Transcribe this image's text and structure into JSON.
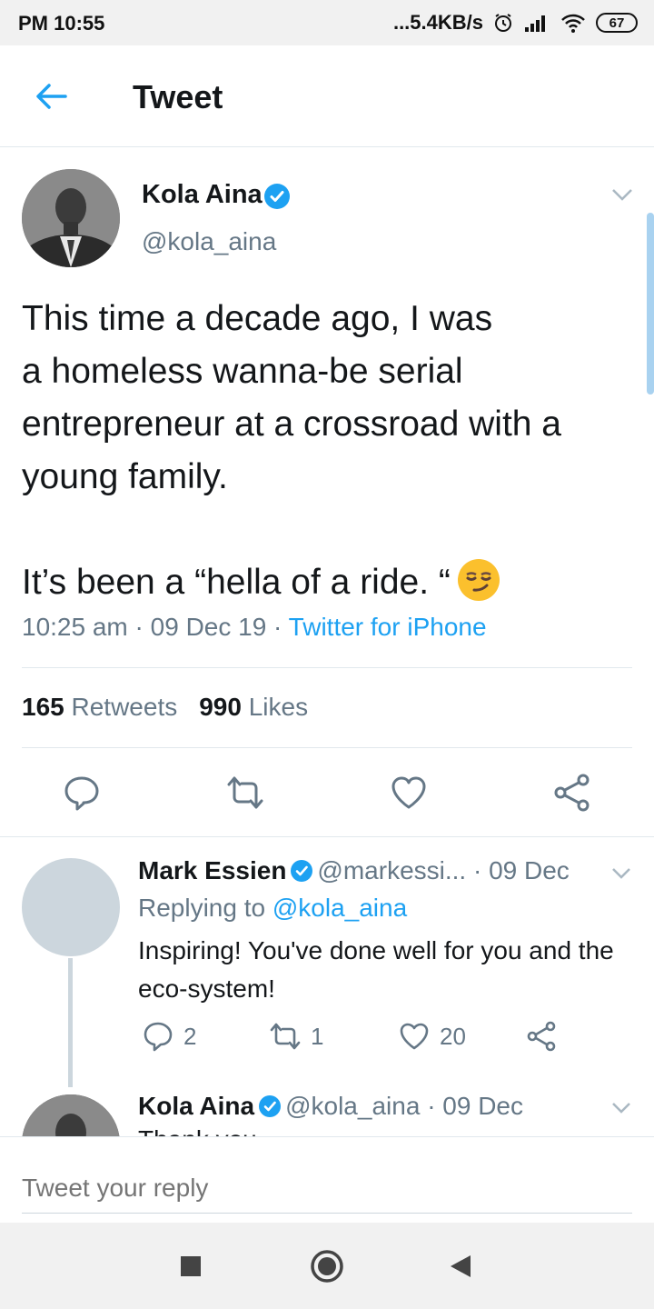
{
  "status_bar": {
    "time": "PM 10:55",
    "network_speed": "...5.4KB/s",
    "battery": "67",
    "icons": [
      "alarm-icon",
      "signal-icon",
      "wifi-icon",
      "battery-icon"
    ]
  },
  "header": {
    "title": "Tweet",
    "back_icon": "back-arrow-icon"
  },
  "tweet": {
    "author_name": "Kola Aina",
    "author_handle": "@kola_aina",
    "verified": true,
    "text": "This time a decade ago, I was\na homeless wanna-be serial\nentrepreneur at a crossroad with a\nyoung family.\n\nIt’s been a “hella of a ride. “",
    "emoji": "smirking-face-emoji",
    "time": "10:25 am",
    "date": "09 Dec 19",
    "source": "Twitter for iPhone",
    "separator": " · ",
    "retweets_count": "165",
    "retweets_label": "Retweets",
    "likes_count": "990",
    "likes_label": "Likes"
  },
  "replies": [
    {
      "name": "Mark Essien",
      "handle": "@markessi...",
      "date": "· 09 Dec",
      "replying_label": "Replying to",
      "replying_to": "@kola_aina",
      "text": "Inspiring! You've done well for you and the eco-system!",
      "reply_count": "2",
      "retweet_count": "1",
      "like_count": "20"
    },
    {
      "name": "Kola Aina",
      "handle": "@kola_aina",
      "date": "· 09 Dec",
      "text_partial": "Thank you"
    }
  ],
  "composer": {
    "placeholder": "Tweet your reply"
  },
  "colors": {
    "accent": "#1da1f2",
    "secondary_text": "#657786",
    "primary_text": "#14171a",
    "divider": "#e1e8ed"
  }
}
